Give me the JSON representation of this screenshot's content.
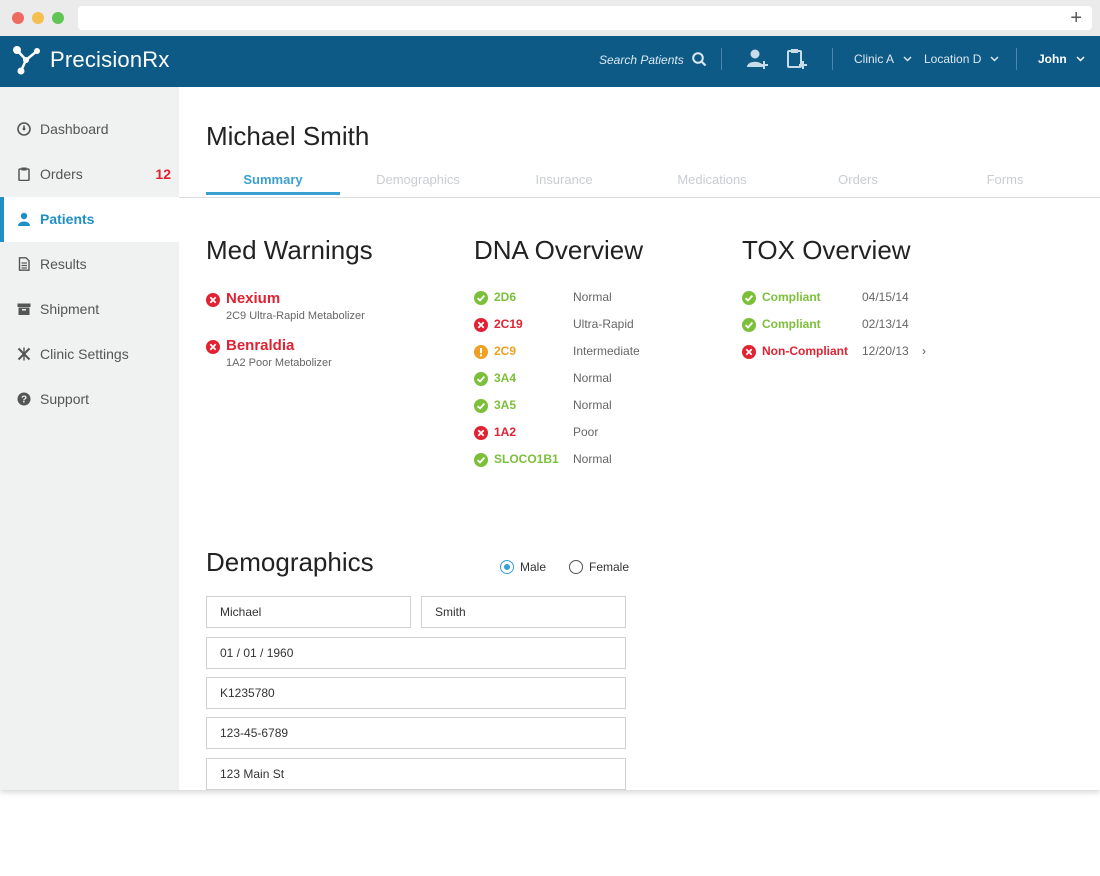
{
  "app": {
    "name": "PrecisionRx"
  },
  "nav": {
    "search_label": "Search Patients",
    "clinic": "Clinic A",
    "location": "Location D",
    "user": "John"
  },
  "sidebar": {
    "items": [
      {
        "label": "Dashboard",
        "icon": "dashboard-gauge-icon"
      },
      {
        "label": "Orders",
        "icon": "clipboard-icon",
        "badge": "12"
      },
      {
        "label": "Patients",
        "icon": "person-icon",
        "active": true
      },
      {
        "label": "Results",
        "icon": "document-icon"
      },
      {
        "label": "Shipment",
        "icon": "box-icon"
      },
      {
        "label": "Clinic Settings",
        "icon": "tools-icon"
      },
      {
        "label": "Support",
        "icon": "question-icon"
      }
    ]
  },
  "patient": {
    "name": "Michael Smith"
  },
  "tabs": [
    "Summary",
    "Demographics",
    "Insurance",
    "Medications",
    "Orders",
    "Forms"
  ],
  "med_warnings": {
    "title": "Med Warnings",
    "items": [
      {
        "name": "Nexium",
        "desc": "2C9 Ultra-Rapid Metabolizer",
        "status": "error"
      },
      {
        "name": "Benraldia",
        "desc": "1A2 Poor Metabolizer",
        "status": "error"
      }
    ]
  },
  "dna": {
    "title": "DNA Overview",
    "items": [
      {
        "gene": "2D6",
        "result": "Normal",
        "status": "ok"
      },
      {
        "gene": "2C19",
        "result": "Ultra-Rapid",
        "status": "error"
      },
      {
        "gene": "2C9",
        "result": "Intermediate",
        "status": "warning"
      },
      {
        "gene": "3A4",
        "result": "Normal",
        "status": "ok"
      },
      {
        "gene": "3A5",
        "result": "Normal",
        "status": "ok"
      },
      {
        "gene": "1A2",
        "result": "Poor",
        "status": "error"
      },
      {
        "gene": "SLOCO1B1",
        "result": "Normal",
        "status": "ok"
      }
    ]
  },
  "tox": {
    "title": "TOX Overview",
    "items": [
      {
        "status_label": "Compliant",
        "date": "04/15/14",
        "status": "ok"
      },
      {
        "status_label": "Compliant",
        "date": "02/13/14",
        "status": "ok"
      },
      {
        "status_label": "Non-Compliant",
        "date": "12/20/13",
        "status": "error",
        "arrow": "›"
      }
    ]
  },
  "demographics": {
    "title": "Demographics",
    "gender": {
      "options": [
        "Male",
        "Female"
      ],
      "selected": "Male"
    },
    "first_name": "Michael",
    "last_name": "Smith",
    "dob": "01 / 01 / 1960",
    "id": "K1235780",
    "ssn": "123-45-6789",
    "address": "123 Main St"
  },
  "colors": {
    "nav_bg": "#0e5a86",
    "accent": "#3aa0cf",
    "ok": "#7cbf3a",
    "error": "#e02232",
    "warning": "#f0a023"
  }
}
